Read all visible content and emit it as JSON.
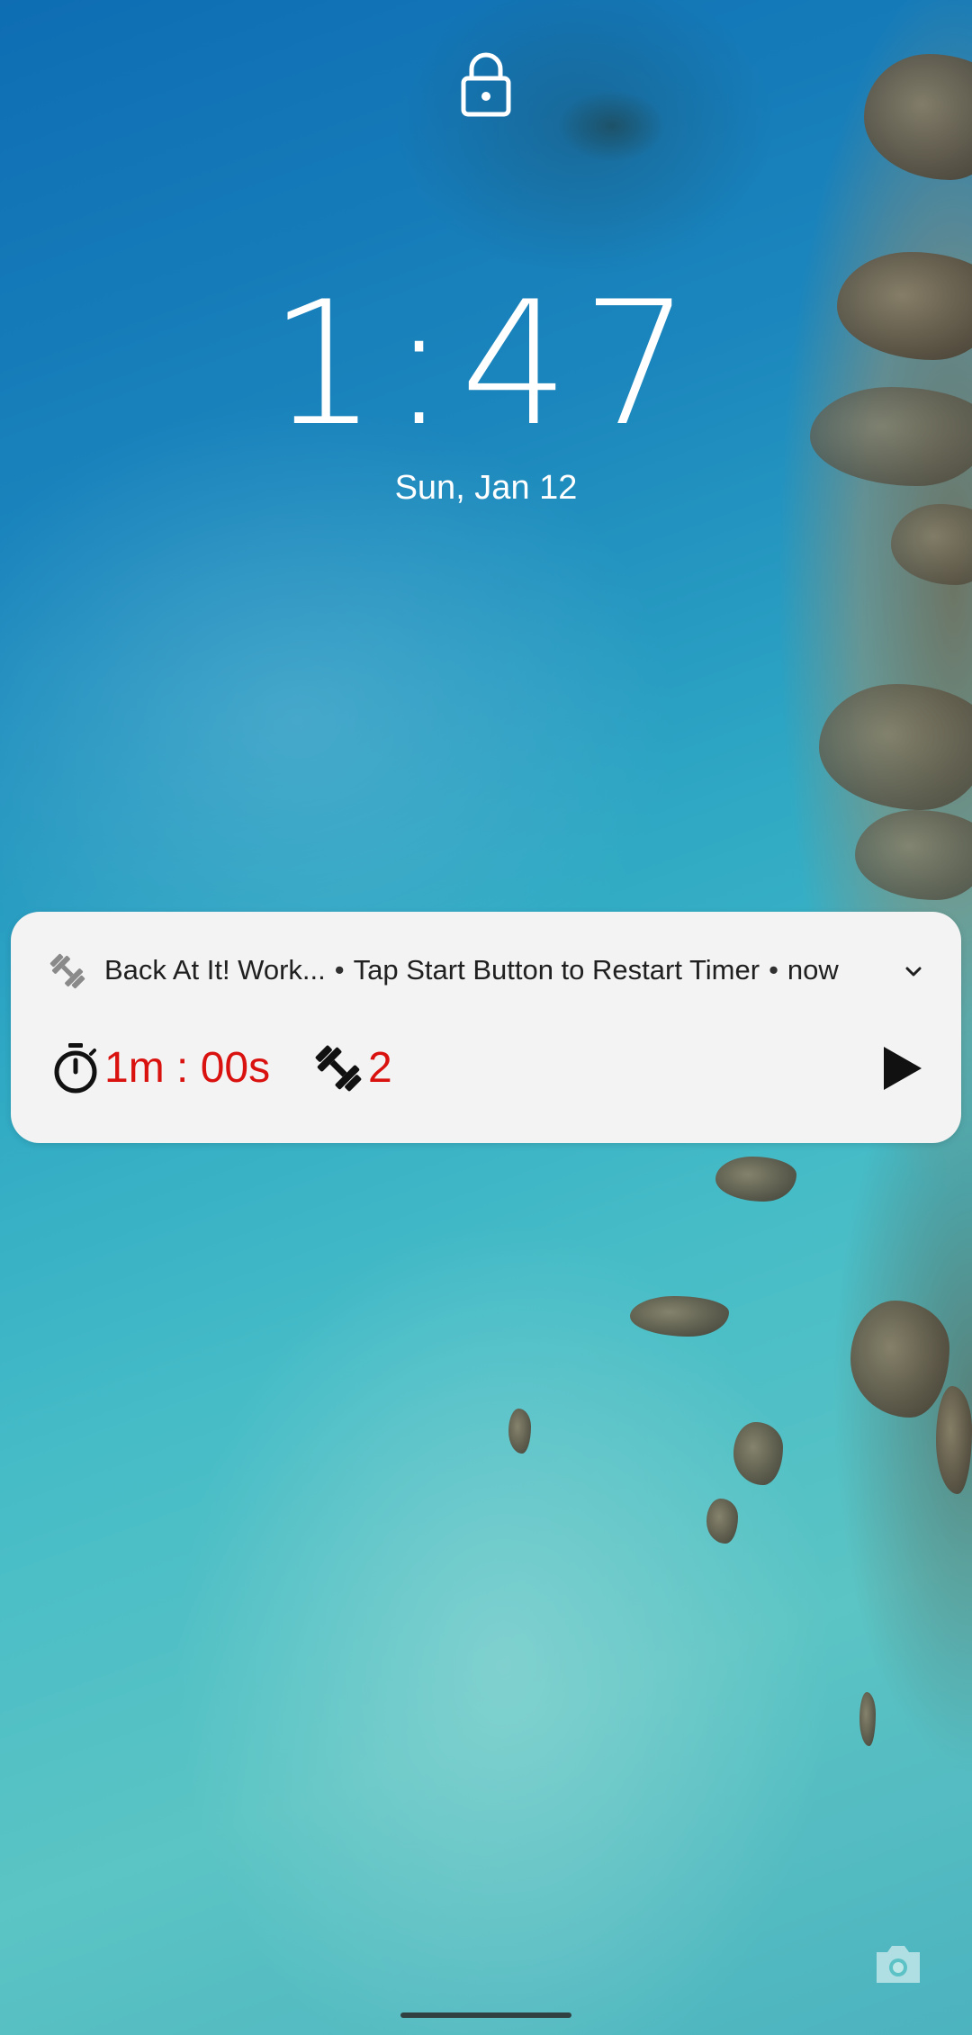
{
  "lockscreen": {
    "time": "1:47",
    "date": "Sun, Jan 12",
    "lock_icon": "lock-icon",
    "camera_icon": "camera-icon"
  },
  "notification": {
    "app_name": "Back At It! Work...",
    "separator": "•",
    "message": "Tap Start Button to Restart Timer",
    "timestamp": "now",
    "app_icon": "dumbbell-icon",
    "expand_icon": "chevron-down-icon",
    "timer_icon": "stopwatch-icon",
    "timer_value": "1m : 00s",
    "sets_icon": "dumbbell-icon",
    "set_count": "2",
    "play_icon": "play-icon",
    "accent_color": "#d9120f"
  }
}
